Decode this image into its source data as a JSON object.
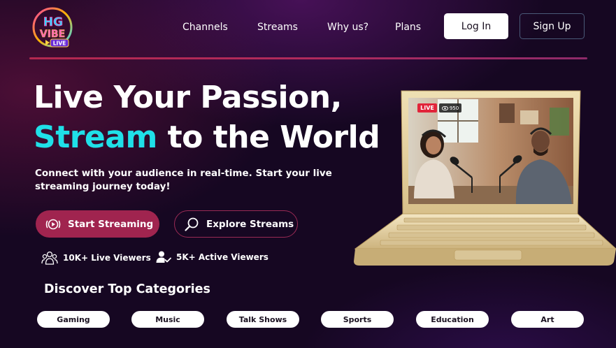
{
  "brand": {
    "logo_top": "HG",
    "logo_mid": "VIBE",
    "logo_tag": "LIVE"
  },
  "nav": {
    "links": [
      "Channels",
      "Streams",
      "Why us?",
      "Plans"
    ],
    "login_label": "Log In",
    "signup_label": "Sign Up"
  },
  "hero": {
    "title_line1": "Live Your Passion,",
    "title_accent": "Stream",
    "title_line2_rest": " to the World",
    "subtitle": "Connect with your audience in real-time. Start your live streaming journey today!",
    "start_label": "Start Streaming",
    "explore_label": "Explore Streams"
  },
  "stats": [
    {
      "icon": "users-group-icon",
      "label": "10K+ Live Viewers"
    },
    {
      "icon": "user-check-icon",
      "label": "5K+ Active Viewers"
    }
  ],
  "preview": {
    "live_label": "LIVE",
    "viewer_count": "950"
  },
  "categories": {
    "heading": "Discover Top Categories",
    "items": [
      "Gaming",
      "Music",
      "Talk Shows",
      "Sports",
      "Education",
      "Art"
    ]
  },
  "colors": {
    "accent_cyan": "#1fe0e8",
    "primary_button": "#a0244f",
    "live_red": "#e1243a",
    "background": "#160722"
  }
}
